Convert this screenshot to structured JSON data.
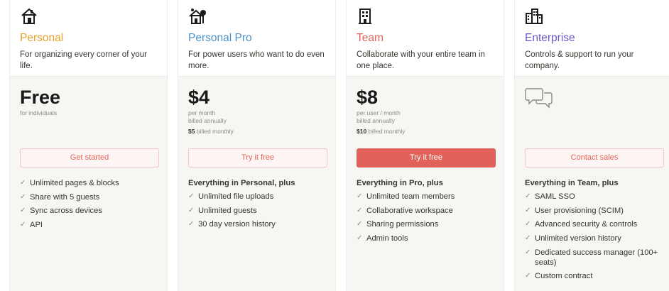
{
  "plans": [
    {
      "name": "Personal",
      "name_color": "#e4a02c",
      "icon": "house-icon",
      "description": "For organizing every corner of your life.",
      "price": "Free",
      "price_sub": [
        "for individuals"
      ],
      "monthly_bold": "",
      "monthly_rest": "",
      "button_label": "Get started",
      "button_style": "outline",
      "features_heading": "",
      "features": [
        "Unlimited pages & blocks",
        "Share with 5 guests",
        "Sync across devices",
        "API"
      ]
    },
    {
      "name": "Personal Pro",
      "name_color": "#4a90c9",
      "icon": "house-tree-icon",
      "description": "For power users who want to do even more.",
      "price": "$4",
      "price_sub": [
        "per month",
        "billed annually"
      ],
      "monthly_bold": "$5",
      "monthly_rest": " billed monthly",
      "button_label": "Try it free",
      "button_style": "outline",
      "features_heading": "Everything in Personal, plus",
      "features": [
        "Unlimited file uploads",
        "Unlimited guests",
        "30 day version history"
      ]
    },
    {
      "name": "Team",
      "name_color": "#e0625a",
      "icon": "office-building-icon",
      "description": "Collaborate with your entire team in one place.",
      "price": "$8",
      "price_sub": [
        "per user / month",
        "billed annually"
      ],
      "monthly_bold": "$10",
      "monthly_rest": " billed monthly",
      "button_label": "Try it free",
      "button_style": "filled",
      "features_heading": "Everything in Pro, plus",
      "features": [
        "Unlimited team members",
        "Collaborative workspace",
        "Sharing permissions",
        "Admin tools"
      ]
    },
    {
      "name": "Enterprise",
      "name_color": "#6a57c8",
      "icon": "city-buildings-icon",
      "description": "Controls & support to run your company.",
      "price": "",
      "price_icon": "chat-bubbles-icon",
      "price_sub": [],
      "monthly_bold": "",
      "monthly_rest": "",
      "button_label": "Contact sales",
      "button_style": "outline",
      "features_heading": "Everything in Team, plus",
      "features": [
        "SAML SSO",
        "User provisioning (SCIM)",
        "Advanced security & controls",
        "Unlimited version history",
        "Dedicated success manager (100+ seats)",
        "Custom contract"
      ]
    }
  ],
  "check_glyph": "✓"
}
